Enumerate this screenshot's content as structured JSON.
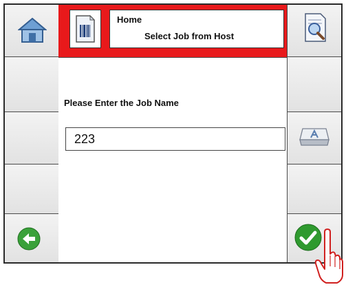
{
  "header": {
    "title": "Home",
    "subtitle": "Select Job from Host"
  },
  "main": {
    "prompt": "Please Enter the Job Name",
    "job_name_value": "223"
  },
  "colors": {
    "header_red": "#e8191b",
    "panel_gray": "#e9e9e9",
    "go_back_green": "#3aa13a",
    "confirm_green": "#2f9a2f"
  },
  "icons": {
    "left_top": "home-icon",
    "header_doc": "barcode-document-icon",
    "right_top": "search-document-icon",
    "right_middle": "keyboard-key-icon",
    "left_bottom": "back-arrow-icon",
    "right_bottom": "checkmark-icon",
    "pointer": "hand-pointer-icon"
  }
}
